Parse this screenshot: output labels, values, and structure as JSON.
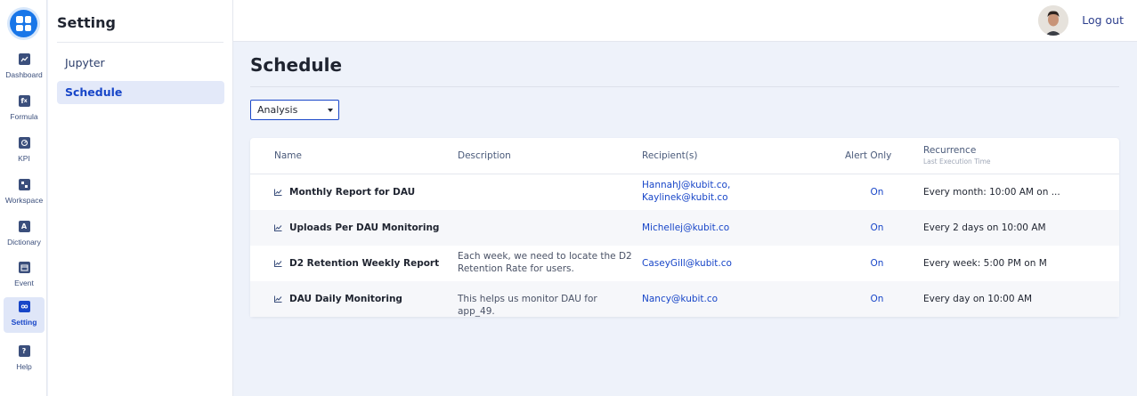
{
  "sidebar": {
    "items": [
      {
        "label": "Dashboard",
        "icon": "dashboard-icon"
      },
      {
        "label": "Formula",
        "icon": "formula-icon"
      },
      {
        "label": "KPI",
        "icon": "kpi-icon"
      },
      {
        "label": "Workspace",
        "icon": "workspace-icon"
      },
      {
        "label": "Dictionary",
        "icon": "dictionary-icon"
      },
      {
        "label": "Event",
        "icon": "calendar-icon"
      },
      {
        "label": "Setting",
        "icon": "settings-icon"
      },
      {
        "label": "Help",
        "icon": "help-icon"
      }
    ],
    "active": "Setting"
  },
  "settings_panel": {
    "title": "Setting",
    "items": [
      "Jupyter",
      "Schedule"
    ],
    "active": "Schedule"
  },
  "topbar": {
    "logout_label": "Log out"
  },
  "main": {
    "title": "Schedule",
    "filter": {
      "selected": "Analysis"
    },
    "table": {
      "columns": {
        "name": "Name",
        "description": "Description",
        "recipients": "Recipient(s)",
        "alert_only": "Alert Only",
        "recurrence": "Recurrence",
        "recurrence_sub": "Last Execution Time"
      },
      "rows": [
        {
          "name": "Monthly Report for DAU",
          "description": "",
          "recipients": [
            "HannahJ@kubit.co,",
            "Kaylinek@kubit.co"
          ],
          "alert_only": "On",
          "recurrence": "Every month: 10:00 AM on ..."
        },
        {
          "name": "Uploads Per DAU Monitoring",
          "description": "",
          "recipients": [
            "Michellej@kubit.co"
          ],
          "alert_only": "On",
          "recurrence": "Every 2 days on 10:00 AM"
        },
        {
          "name": "D2 Retention Weekly Report",
          "description": "Each week, we need to locate the D2 Retention Rate for users.",
          "recipients": [
            "CaseyGill@kubit.co"
          ],
          "alert_only": "On",
          "recurrence": "Every week: 5:00 PM on M"
        },
        {
          "name": "DAU Daily Monitoring",
          "description": "This helps us monitor DAU for app_49.",
          "recipients": [
            "Nancy@kubit.co"
          ],
          "alert_only": "On",
          "recurrence": "Every day on 10:00 AM"
        }
      ]
    }
  },
  "colors": {
    "accent": "#1846c8",
    "logo": "#1976e8",
    "page_background": "#eef2fa",
    "active_nav_background": "#dfe6f8"
  }
}
